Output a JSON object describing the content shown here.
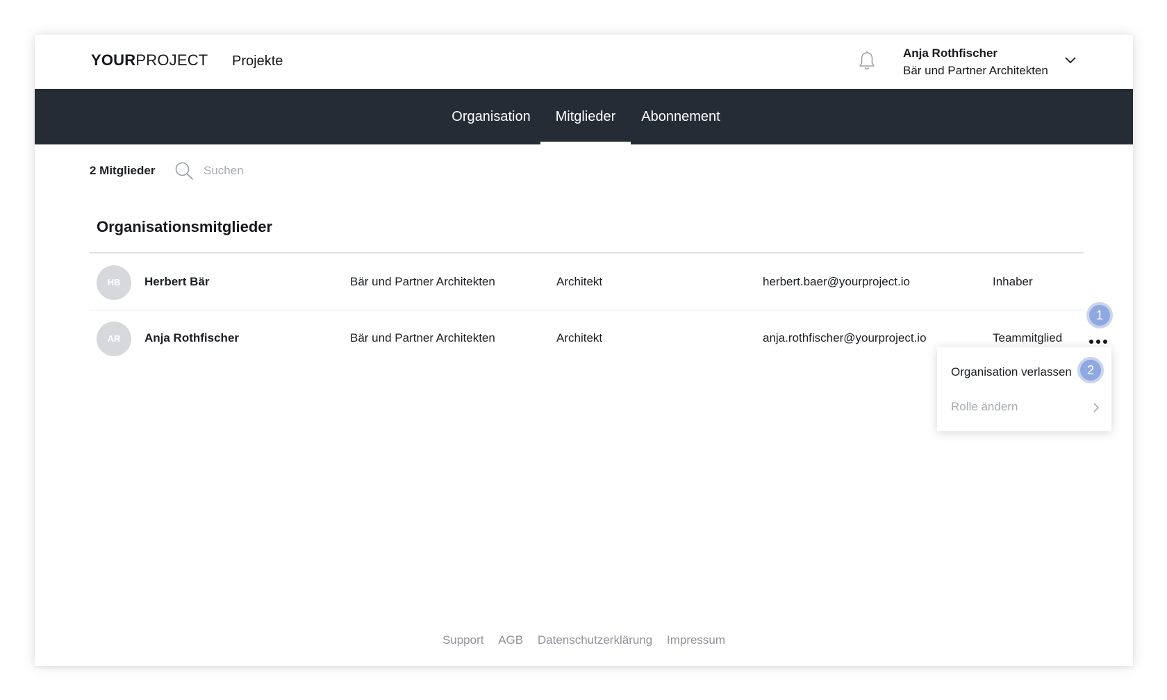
{
  "header": {
    "logo_bold": "YOUR",
    "logo_regular": "PROJECT",
    "nav_projects": "Projekte",
    "user_name": "Anja Rothfischer",
    "user_org": "Bär und Partner Architekten",
    "icons": [
      "bell-icon",
      "chevron-down-icon"
    ]
  },
  "tabs": [
    {
      "label": "Organisation",
      "active": false
    },
    {
      "label": "Mitglieder",
      "active": true
    },
    {
      "label": "Abonnement",
      "active": false
    }
  ],
  "toolbar": {
    "member_count": "2 Mitglieder",
    "search_placeholder": "Suchen",
    "search_value": ""
  },
  "section": {
    "title": "Organisationsmitglieder"
  },
  "members": [
    {
      "initials": "HB",
      "name": "Herbert Bär",
      "organisation": "Bär und Partner Architekten",
      "profession": "Architekt",
      "email": "herbert.baer@yourproject.io",
      "role": "Inhaber"
    },
    {
      "initials": "AR",
      "name": "Anja Rothfischer",
      "organisation": "Bär und Partner Architekten",
      "profession": "Architekt",
      "email": "anja.rothfischer@yourproject.io",
      "role": "Teammitglied"
    }
  ],
  "menu": {
    "leave": "Organisation verlassen",
    "change_role": "Rolle ändern"
  },
  "badges": {
    "first": "1",
    "second": "2"
  },
  "footer": {
    "links": [
      "Support",
      "AGB",
      "Datenschutzerklärung",
      "Impressum"
    ]
  },
  "colors": {
    "tabbar_bg": "#252c35",
    "badge": "#8fa9e0",
    "avatar_bg": "#d6d8db",
    "muted_text": "#a7abb0"
  }
}
